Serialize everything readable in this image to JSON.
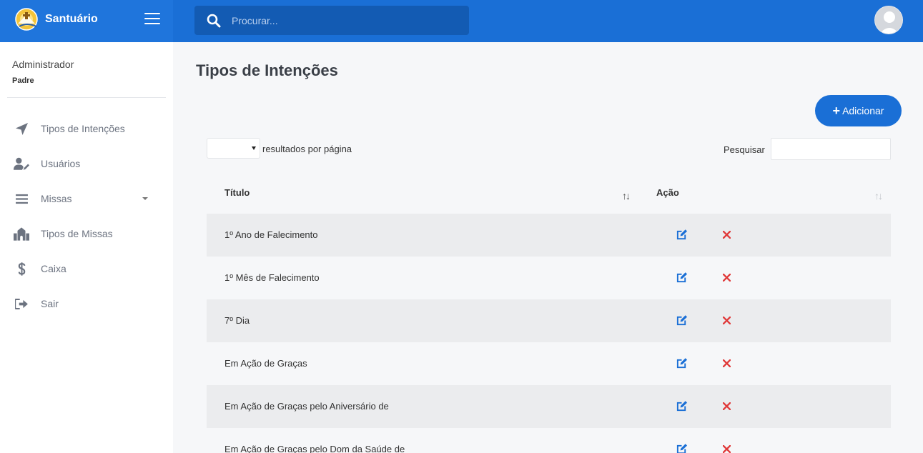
{
  "app": {
    "name": "Santuário"
  },
  "search": {
    "placeholder": "Procurar..."
  },
  "user": {
    "role": "Administrador",
    "name": "Padre"
  },
  "sidebar": {
    "items": [
      {
        "label": "Tipos de Intenções",
        "icon": "paper-plane-icon"
      },
      {
        "label": "Usuários",
        "icon": "user-edit-icon"
      },
      {
        "label": "Missas",
        "icon": "bars-icon",
        "has_submenu": true
      },
      {
        "label": "Tipos de Missas",
        "icon": "church-icon"
      },
      {
        "label": "Caixa",
        "icon": "dollar-icon"
      },
      {
        "label": "Sair",
        "icon": "sign-out-icon"
      }
    ]
  },
  "main": {
    "title": "Tipos de Intenções",
    "add_label": "Adicionar",
    "length_label": "resultados por página",
    "length_value": "",
    "filter_label": "Pesquisar",
    "filter_value": "",
    "table": {
      "columns": [
        "Título",
        "Ação"
      ],
      "rows": [
        {
          "title": "1º Ano de Falecimento"
        },
        {
          "title": "1º Mês de Falecimento"
        },
        {
          "title": "7º Dia"
        },
        {
          "title": "Em Ação de Graças"
        },
        {
          "title": "Em Ação de Graças pelo Aniversário de"
        },
        {
          "title": "Em Ação de Graças pelo Dom da Saúde de"
        }
      ]
    }
  },
  "colors": {
    "primary": "#1a6fd6",
    "edit": "#1a6fd6",
    "delete": "#e03a3a",
    "row_stripe": "#ebecee"
  }
}
